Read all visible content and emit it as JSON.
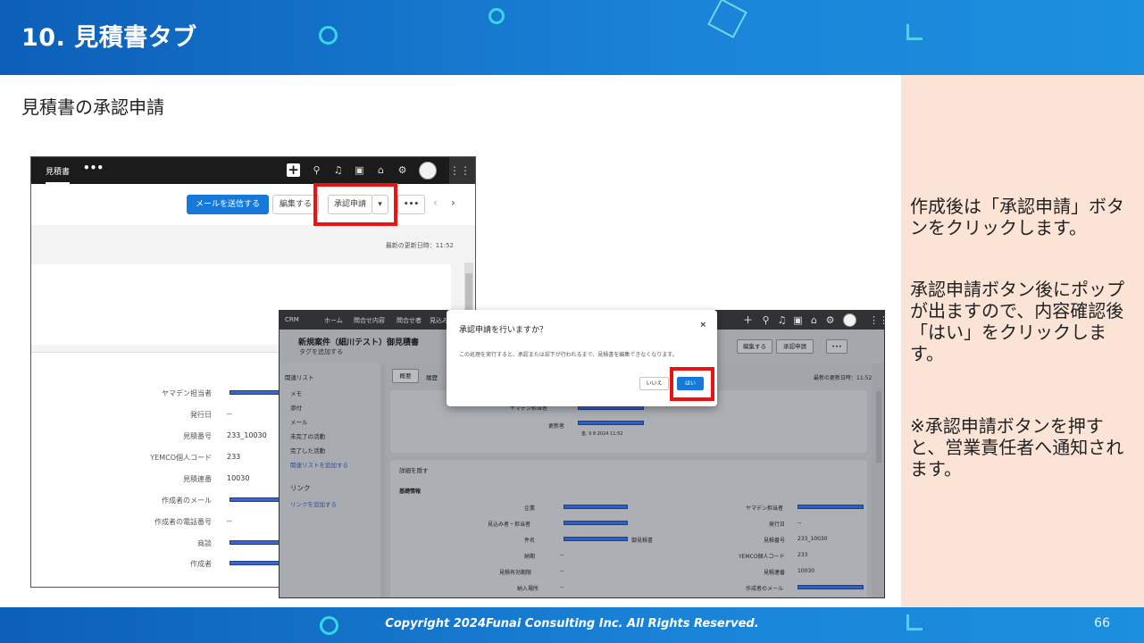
{
  "slide": {
    "title": "10. 見積書タブ",
    "subtitle": "見積書の承認申請",
    "copyright": "Copyright 2024Funai Consulting Inc. All Rights Reserved.",
    "page_number": "66",
    "colors": {
      "header": "#1572cc",
      "accent_red": "#ee1111",
      "panel": "#fbe3d6"
    }
  },
  "notes": {
    "p1": "作成後は「承認申請」ボタンをクリックします。",
    "p2": "承認申請ボタン後にポップが出ますので、内容確認後「はい」をクリックします。",
    "p3": "※承認申請ボタンを押すと、営業責任者へ通知されます。"
  },
  "screen1": {
    "tab": "見積書",
    "more": "•••",
    "icons": [
      "plus-icon",
      "search-icon",
      "bell-icon",
      "calendar-icon",
      "store-icon",
      "gear-icon",
      "avatar",
      "app-grid-icon"
    ],
    "buttons": {
      "send_email": "メールを送信する",
      "edit": "編集する",
      "approval": "承認申請",
      "dropdown": "▾",
      "more": "•••",
      "prev": "‹",
      "next": "›"
    },
    "updated": "最新の更新日時：11:52",
    "fields": [
      {
        "label": "ヤマデン担当者",
        "value": ""
      },
      {
        "label": "発行日",
        "value": "--"
      },
      {
        "label": "見積番号",
        "value": "233_10030"
      },
      {
        "label": "YEMCO個人コード",
        "value": "233"
      },
      {
        "label": "見積連番",
        "value": "10030"
      },
      {
        "label": "作成者のメール",
        "value": ""
      },
      {
        "label": "作成者の電話番号",
        "value": "--"
      },
      {
        "label": "商談",
        "value": ""
      },
      {
        "label": "作成者",
        "value": ""
      }
    ]
  },
  "screen2": {
    "nav": [
      "CRM",
      "ホーム",
      "問合せ内容",
      "問合せ者",
      "見込み"
    ],
    "title": "新規案件（細川テスト）御見積書",
    "add_tag": "タグを追加する",
    "buttons": {
      "edit": "編集する",
      "approval": "承認申請",
      "more": "•••"
    },
    "updated": "最新の更新日時：11:52",
    "tabs": [
      "概要",
      "履歴"
    ],
    "sidebar": {
      "related_list": "関連リスト",
      "items": [
        "メモ",
        "添付",
        "メール",
        "未完了の活動",
        "完了した活動"
      ],
      "add_related": "関連リストを追加する",
      "links": "リンク",
      "add_link": "リンクを追加する"
    },
    "summary": {
      "yamaden": "ヤマデン担当者",
      "updater": "更新者",
      "updated_at": "金, 9 8 2024 11:52"
    },
    "details_link": "詳細を隠す",
    "section": "基礎情報",
    "left_fields": [
      {
        "label": "企業",
        "value": ""
      },
      {
        "label": "見込み者・担当者",
        "value": ""
      },
      {
        "label": "件名",
        "value": "御見積書"
      },
      {
        "label": "納期",
        "value": "--"
      },
      {
        "label": "見積有効期限",
        "value": "--"
      },
      {
        "label": "納入場所",
        "value": "--"
      }
    ],
    "right_fields": [
      {
        "label": "ヤマデン担当者",
        "value": ""
      },
      {
        "label": "発行日",
        "value": "--"
      },
      {
        "label": "見積番号",
        "value": "233_10030"
      },
      {
        "label": "YEMCO個人コード",
        "value": "233"
      },
      {
        "label": "見積連番",
        "value": "10030"
      },
      {
        "label": "作成者のメール",
        "value": ""
      }
    ]
  },
  "dialog": {
    "title": "承認申請を行いますか？",
    "close": "×",
    "body": "この処理を実行すると、承認または却下が行われるまで、見積書を編集できなくなります。",
    "no": "いいえ",
    "yes": "はい"
  }
}
